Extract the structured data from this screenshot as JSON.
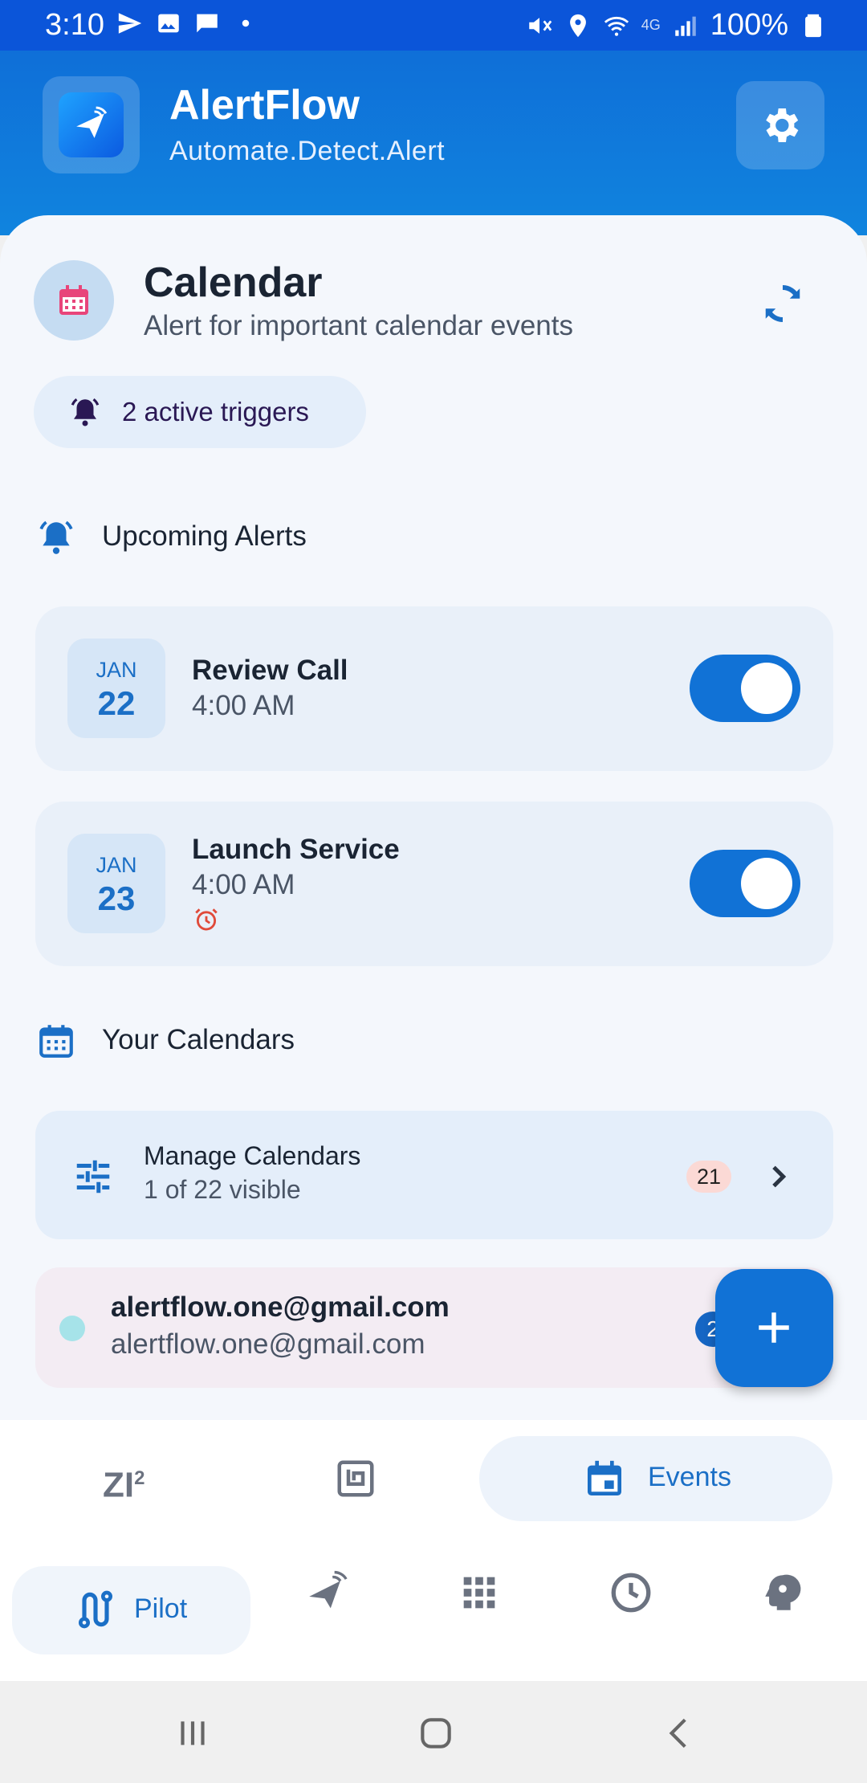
{
  "status_bar": {
    "time": "3:10",
    "battery": "100%",
    "network": "4G"
  },
  "header": {
    "app_name": "AlertFlow",
    "tagline": "Automate.Detect.Alert"
  },
  "calendar_section": {
    "title": "Calendar",
    "subtitle": "Alert for important calendar events",
    "trigger_chip": "2 active triggers"
  },
  "upcoming": {
    "heading": "Upcoming Alerts",
    "items": [
      {
        "month": "JAN",
        "day": "22",
        "title": "Review Call",
        "time": "4:00 AM",
        "enabled": true,
        "alarm": false
      },
      {
        "month": "JAN",
        "day": "23",
        "title": "Launch Service",
        "time": "4:00 AM",
        "enabled": true,
        "alarm": true
      }
    ]
  },
  "calendars": {
    "heading": "Your Calendars",
    "manage": {
      "title": "Manage Calendars",
      "subtitle": "1 of 22 visible",
      "badge": "21"
    },
    "account": {
      "name": "alertflow.one@gmail.com",
      "email": "alertflow.one@gmail.com",
      "badge": "2",
      "color": "#a6e3e9"
    }
  },
  "inner_tabs": {
    "zi_label": "ZI",
    "zi_sup": "2",
    "events_label": "Events"
  },
  "bottom_nav": {
    "pilot_label": "Pilot"
  },
  "colors": {
    "primary": "#1172d6",
    "header": "#0f6fd8",
    "statusbar": "#0b55d9"
  }
}
